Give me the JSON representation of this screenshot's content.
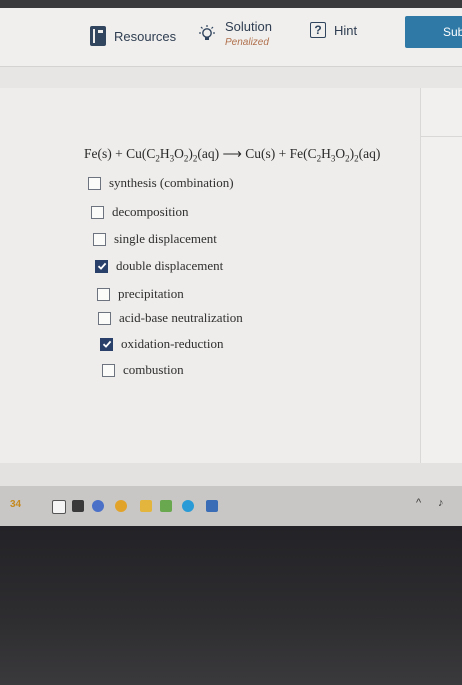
{
  "toolbar": {
    "resources_label": "Resources",
    "solution_label": "Solution",
    "solution_status": "Penalized",
    "hint_label": "Hint",
    "submit_label": "Sub"
  },
  "equation": {
    "reactant1": "Fe(s)",
    "plus1": "+",
    "reactant2_prefix": "Cu(C",
    "reactant2_sub1": "2",
    "reactant2_h": "H",
    "reactant2_sub2": "3",
    "reactant2_o": "O",
    "reactant2_sub3": "2",
    "reactant2_close": ")",
    "reactant2_sub4": "2",
    "reactant2_state": "(aq)",
    "arrow": "⟶",
    "product1": "Cu(s)",
    "plus2": "+",
    "product2_prefix": "Fe(C",
    "product2_sub1": "2",
    "product2_h": "H",
    "product2_sub2": "3",
    "product2_o": "O",
    "product2_sub3": "2",
    "product2_close": ")",
    "product2_sub4": "2",
    "product2_state": "(aq)"
  },
  "options": [
    {
      "label": "synthesis (combination)",
      "checked": false
    },
    {
      "label": "decomposition",
      "checked": false
    },
    {
      "label": "single displacement",
      "checked": false
    },
    {
      "label": "double displacement",
      "checked": true
    },
    {
      "label": "precipitation",
      "checked": false
    },
    {
      "label": "acid-base neutralization",
      "checked": false
    },
    {
      "label": "oxidation-reduction",
      "checked": true
    },
    {
      "label": "combustion",
      "checked": false
    }
  ],
  "taskbar": {
    "weather_text": "34",
    "tray_chevron": "^",
    "tray_icon": "♪"
  },
  "colors": {
    "submit": "#2e79a6",
    "checkbox_checked": "#29416a",
    "penalized": "#b0704d"
  }
}
